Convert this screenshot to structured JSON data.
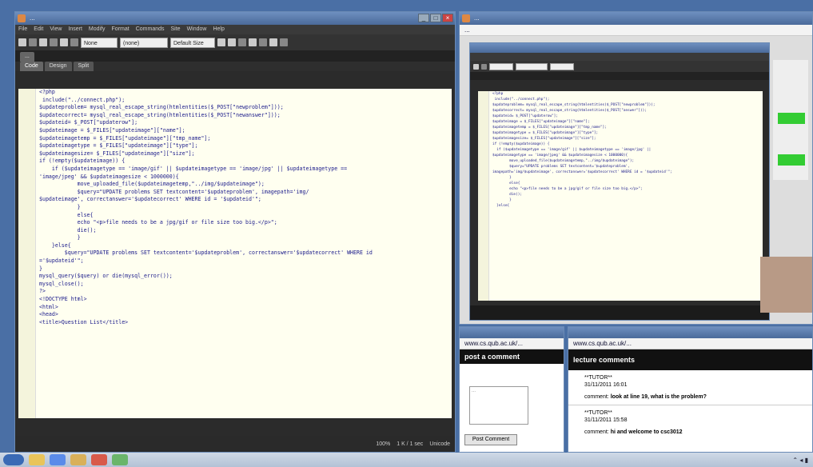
{
  "editor": {
    "title": "...",
    "menu": [
      "File",
      "Edit",
      "View",
      "Insert",
      "Modify",
      "Format",
      "Commands",
      "Site",
      "Window",
      "Help"
    ],
    "selects": [
      "None",
      "(none)",
      "Default Size"
    ],
    "tabs": [
      "...",
      "Code",
      "Design",
      "Split"
    ],
    "code_lines": [
      "<?php",
      " include(\"../connect.php\");",
      "",
      "$updateproblem= mysql_real_escape_string(htmlentities($_POST[\"newproblem\"]));",
      "$updatecorrect= mysql_real_escape_string(htmlentities($_POST[\"newanswer\"]));",
      "$updateid= $_POST[\"updaterow\"];",
      "",
      "$updateimage = $_FILES[\"updateimage\"][\"name\"];",
      "$updateimagetemp = $_FILES[\"updateimage\"][\"tmp_name\"];",
      "$updateimagetype = $_FILES[\"updateimage\"][\"type\"];",
      "$updateimagesize= $_FILES[\"updateimage\"][\"size\"];",
      "",
      "if (!empty($updateimage)) {",
      "",
      "    if ($updateimagetype == 'image/gif' || $updateimagetype == 'image/jpg' || $updateimagetype ==",
      "'image/jpeg' && $updateimagesize < 1000000){",
      "",
      "            move_uploaded_file($updateimagetemp,\"../img/$updateimage\");",
      "",
      "            $query=\"UPDATE problems SET textcontent='$updateproblem', imagepath='img/",
      "$updateimage', correctanswer='$updatecorrect' WHERE id = '$updateid'\";",
      "            }",
      "",
      "            else{",
      "            echo \"<p>file needs to be a jpg/gif or file size too big.</p>\";",
      "            die();",
      "            }",
      "    }else{",
      "",
      "        $query=\"UPDATE problems SET textcontent='$updateproblem', correctanswer='$updatecorrect' WHERE id",
      "='$updateid'\";",
      "",
      "}",
      "",
      "mysql_query($query) or die(mysql_error());",
      "mysql_close();",
      "?>",
      "",
      "<!DOCTYPE html>",
      "<html>",
      "<head>",
      "",
      "<title>Question List</title>"
    ],
    "status": [
      "100%",
      "1 K / 1 sec",
      "Unicode"
    ]
  },
  "video": {
    "title": "...",
    "addr": "...",
    "code_lines": [
      "<?php",
      " include(\"../connect.php\");",
      "",
      "$updateproblem= mysql_real_escape_string(htmlentities($_POST[\"newproblem\"]));",
      "$updatecorrect= mysql_real_escape_string(htmlentities($_POST[\"answer\"]));",
      "$updateid= $_POST[\"updaterow\"];",
      "",
      "$updateimage = $_FILES[\"updateimage\"][\"name\"];",
      "$updateimagetemp = $_FILES[\"updateimage\"][\"tmp_name\"];",
      "$updateimagetype = $_FILES[\"updateimage\"][\"type\"];",
      "$updateimagesize= $_FILES[\"updateimage\"][\"size\"];",
      "",
      "if (!empty($updateimage)) {",
      "",
      "  if ($updateimagetype == 'image/gif' || $updateimagetype == 'image/jpg' ||",
      "$updateimagetype == 'image/jpeg' && $updateimagesize < 1000000){",
      "",
      "        move_uploaded_file($updateimagetemp,\"../img/$updateimage\");",
      "",
      "        $query=\"UPDATE problems SET textcontent='$updateproblem',",
      "imagepath='img/$updateimage', correctanswer='$updatecorrect' WHERE id = '$updateid'\";",
      "        }",
      "",
      "        else{",
      "        echo \"<p>file needs to be a jpg/gif or file size too big.</p>\";",
      "        die();",
      "        }",
      "  }else{"
    ]
  },
  "post_window": {
    "addr": "www.cs.qub.ac.uk/...",
    "header": "post a comment",
    "textarea_placeholder": "...",
    "button": "Post Comment"
  },
  "comments_window": {
    "addr": "www.cs.qub.ac.uk/...",
    "header": "lecture comments",
    "comments": [
      {
        "author": "**TUTOR**",
        "date": "31/11/2011 16:01",
        "label": "comment:",
        "text": "look at line 19, what is the problem?"
      },
      {
        "author": "**TUTOR**",
        "date": "31/11/2011 15:58",
        "label": "comment:",
        "text": "hi and welcome to csc3012"
      }
    ]
  }
}
